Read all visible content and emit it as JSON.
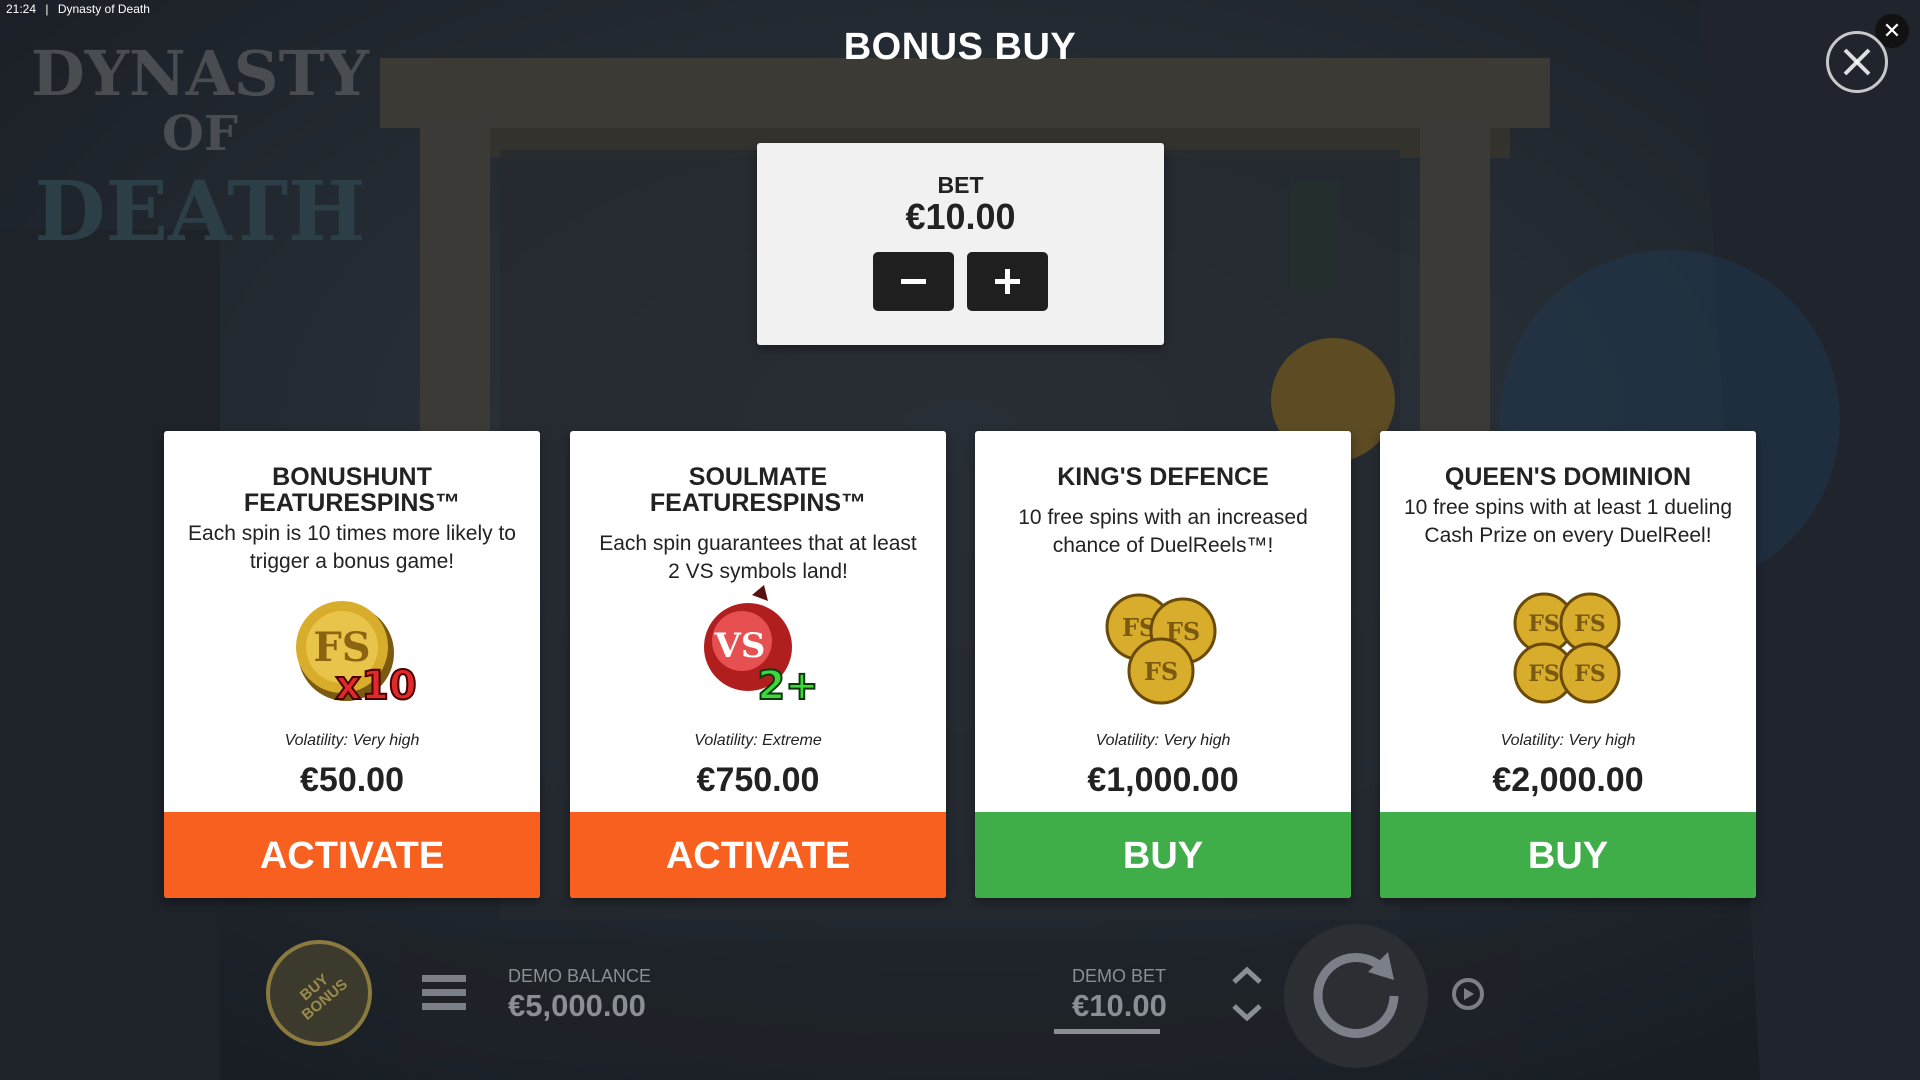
{
  "status_bar": {
    "time": "21:24",
    "separator": "|",
    "tab_title": "Dynasty of Death"
  },
  "game": {
    "logo_text": [
      "DYNASTY",
      "OF",
      "DEATH"
    ]
  },
  "dialog": {
    "title": "BONUS BUY"
  },
  "bet": {
    "label": "BET",
    "value": "€10.00",
    "decrease_symbol": "−",
    "increase_symbol": "+"
  },
  "cards": [
    {
      "title": "BONUSHUNT FEATURESPINS™",
      "description": "Each spin is 10 times more likely to trigger a bonus game!",
      "icon": "fs-coin-x10-icon",
      "volatility": "Volatility: Very high",
      "price": "€50.00",
      "button": "ACTIVATE",
      "button_color": "#f8601f"
    },
    {
      "title": "SOULMATE FEATURESPINS™",
      "description": "Each spin guarantees that at least 2 VS symbols land!",
      "icon": "vs-pomegranate-2plus-icon",
      "volatility": "Volatility: Extreme",
      "price": "€750.00",
      "button": "ACTIVATE",
      "button_color": "#f8601f"
    },
    {
      "title": "KING'S DEFENCE",
      "description": "10 free spins with an increased chance of DuelReels™!",
      "icon": "fs-coins-three-icon",
      "volatility": "Volatility: Very high",
      "price": "€1,000.00",
      "button": "BUY",
      "button_color": "#3fae49"
    },
    {
      "title": "QUEEN'S DOMINION",
      "description": "10 free spins with at least 1 dueling Cash Prize on every DuelReel!",
      "icon": "fs-coins-four-icon",
      "volatility": "Volatility: Very high",
      "price": "€2,000.00",
      "button": "BUY",
      "button_color": "#3fae49"
    }
  ],
  "bottom_bar": {
    "buy_bonus_label": "BUY BONUS",
    "balance_label": "DEMO BALANCE",
    "balance_value": "€5,000.00",
    "bet_label": "DEMO BET",
    "bet_value": "€10.00"
  }
}
